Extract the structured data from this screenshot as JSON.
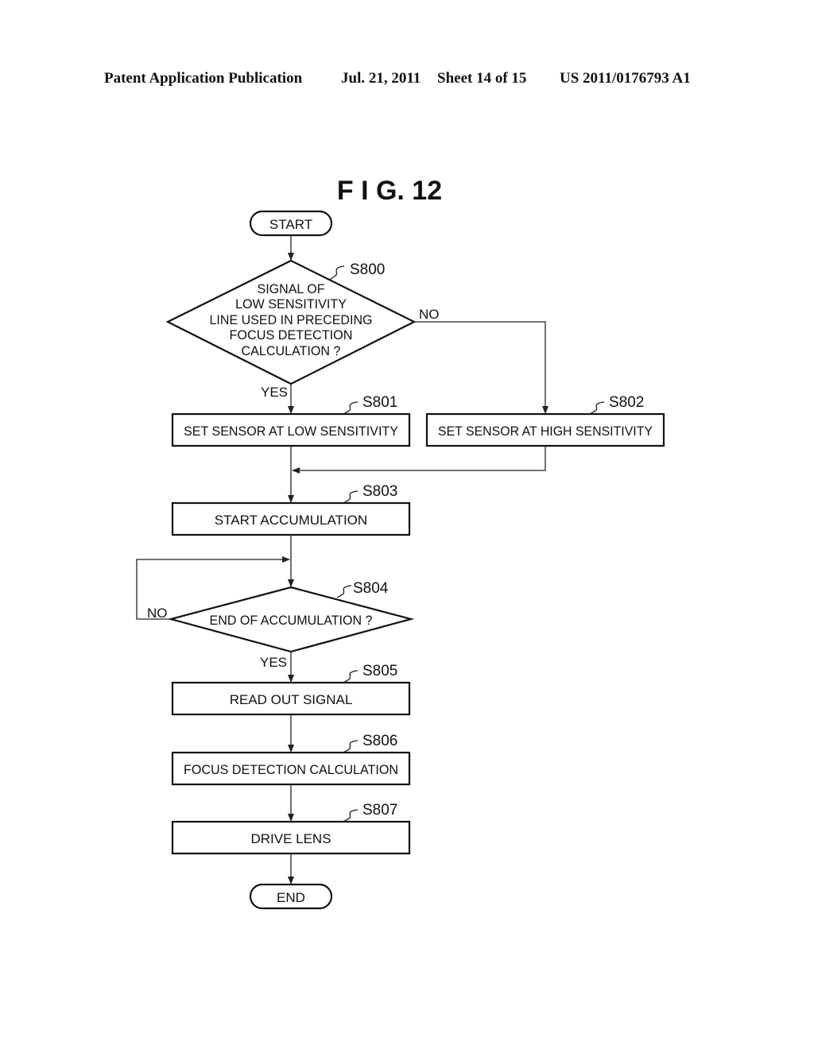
{
  "header": {
    "publication": "Patent Application Publication",
    "date": "Jul. 21, 2011",
    "sheet": "Sheet 14 of 15",
    "number": "US 2011/0176793 A1"
  },
  "figure": {
    "title": "F I G.  12"
  },
  "flowchart": {
    "start": "START",
    "end": "END",
    "steps": {
      "s800": {
        "id": "S800",
        "type": "decision",
        "lines": [
          "SIGNAL OF",
          "LOW SENSITIVITY",
          "LINE USED IN PRECEDING",
          "FOCUS DETECTION",
          "CALCULATION ?"
        ],
        "yes": "YES",
        "no": "NO"
      },
      "s801": {
        "id": "S801",
        "type": "process",
        "text": "SET SENSOR AT LOW SENSITIVITY"
      },
      "s802": {
        "id": "S802",
        "type": "process",
        "text": "SET SENSOR AT HIGH SENSITIVITY"
      },
      "s803": {
        "id": "S803",
        "type": "process",
        "text": "START ACCUMULATION"
      },
      "s804": {
        "id": "S804",
        "type": "decision",
        "lines": [
          "END OF ACCUMULATION ?"
        ],
        "yes": "YES",
        "no": "NO"
      },
      "s805": {
        "id": "S805",
        "type": "process",
        "text": "READ OUT SIGNAL"
      },
      "s806": {
        "id": "S806",
        "type": "process",
        "text": "FOCUS DETECTION CALCULATION"
      },
      "s807": {
        "id": "S807",
        "type": "process",
        "text": "DRIVE LENS"
      }
    }
  }
}
